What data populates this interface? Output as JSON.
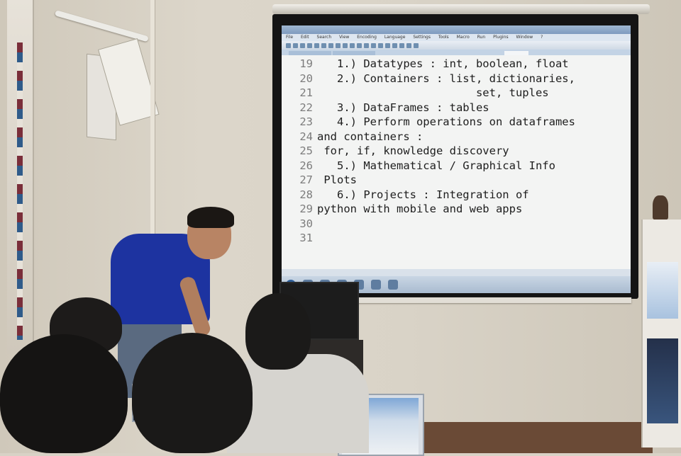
{
  "scene": {
    "description_hidden": ""
  },
  "notepad": {
    "title": "",
    "menus": [
      "File",
      "Edit",
      "Search",
      "View",
      "Encoding",
      "Language",
      "Settings",
      "Tools",
      "Macro",
      "Run",
      "Plugins",
      "Window",
      "?"
    ],
    "lines": [
      {
        "num": "19",
        "text": "   1.) Datatypes : int, boolean, float"
      },
      {
        "num": "20",
        "text": "   2.) Containers : list, dictionaries,"
      },
      {
        "num": "21",
        "text": "                        set, tuples"
      },
      {
        "num": "22",
        "text": "   3.) DataFrames : tables"
      },
      {
        "num": "23",
        "text": "   4.) Perform operations on dataframes"
      },
      {
        "num": "24",
        "text": "and containers :"
      },
      {
        "num": "25",
        "text": " for, if, knowledge discovery"
      },
      {
        "num": "26",
        "text": "   5.) Mathematical / Graphical Info"
      },
      {
        "num": "27",
        "text": " Plots"
      },
      {
        "num": "28",
        "text": "   6.) Projects : Integration of"
      },
      {
        "num": "29",
        "text": "python with mobile and web apps"
      },
      {
        "num": "30",
        "text": ""
      },
      {
        "num": "31",
        "text": ""
      }
    ],
    "status_left": "",
    "status_right": ""
  }
}
